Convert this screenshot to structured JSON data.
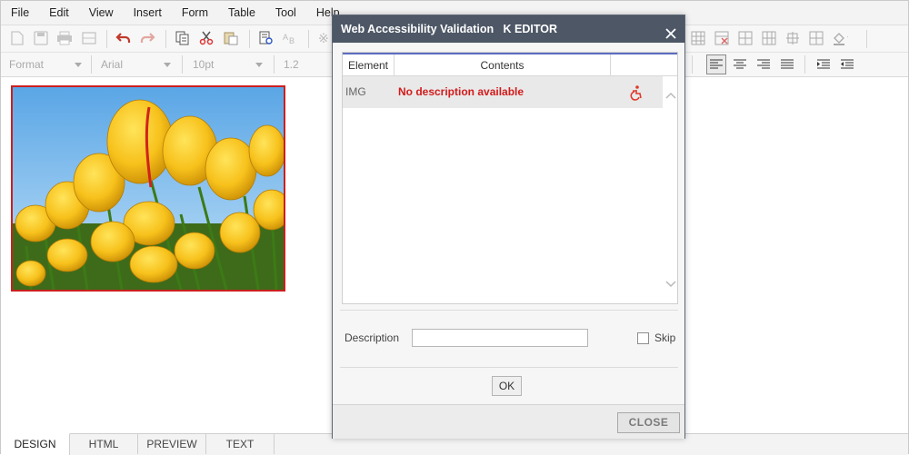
{
  "menubar": {
    "items": [
      "File",
      "Edit",
      "View",
      "Insert",
      "Form",
      "Table",
      "Tool",
      "Help"
    ]
  },
  "toolbar2": {
    "format_value": "Format",
    "font_value": "Arial",
    "size_value": "10pt",
    "line_height_value": "1.2"
  },
  "editor": {
    "image_icon": "tulip-photo"
  },
  "bottom_tabs": [
    "DESIGN",
    "HTML",
    "PREVIEW",
    "TEXT"
  ],
  "dialog": {
    "title": "Web Accessibility Validation",
    "subtitle": "K EDITOR",
    "columns": {
      "element": "Element",
      "contents": "Contents"
    },
    "rows": [
      {
        "element": "IMG",
        "contents": "No description available",
        "icon": "accessibility-icon"
      }
    ],
    "description_label": "Description",
    "description_value": "",
    "skip_label": "Skip",
    "ok_label": "OK",
    "close_label": "CLOSE"
  },
  "colors": {
    "dialog_title_bg": "#4d5766",
    "error_red": "#d21b1b",
    "image_border": "#cc1f1f"
  }
}
